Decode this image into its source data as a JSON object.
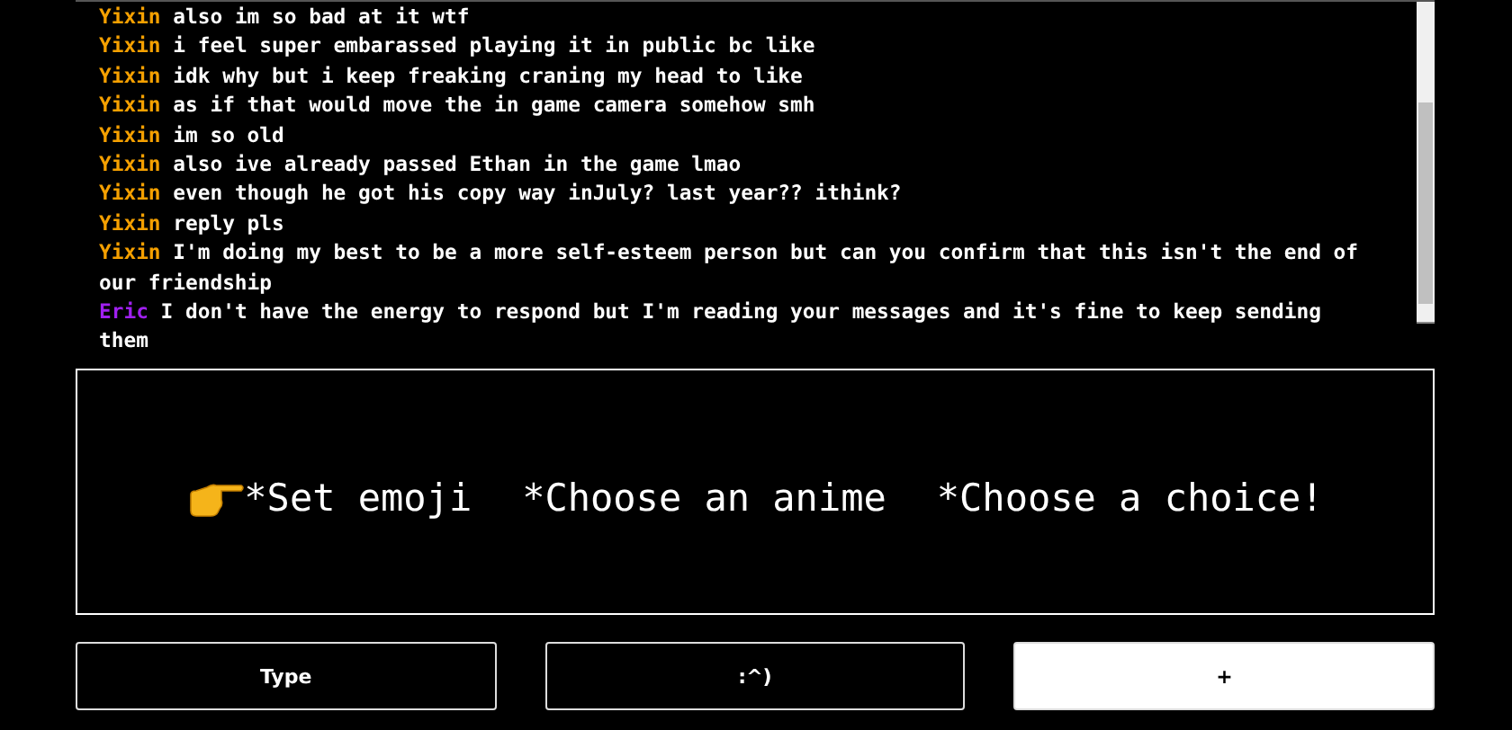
{
  "messages": [
    {
      "author": "Yixin",
      "color": "#f5a000",
      "text": "also im so bad at it wtf"
    },
    {
      "author": "Yixin",
      "color": "#f5a000",
      "text": "i feel super embarassed playing it in public bc like"
    },
    {
      "author": "Yixin",
      "color": "#f5a000",
      "text": "idk why but i keep freaking craning my head to like"
    },
    {
      "author": "Yixin",
      "color": "#f5a000",
      "text": "as if that would move the in game camera somehow smh"
    },
    {
      "author": "Yixin",
      "color": "#f5a000",
      "text": "im so old"
    },
    {
      "author": "Yixin",
      "color": "#f5a000",
      "text": "also ive already passed Ethan in the game lmao"
    },
    {
      "author": "Yixin",
      "color": "#f5a000",
      "text": "even though he got his copy way inJuly? last year?? ithink?"
    },
    {
      "author": "Yixin",
      "color": "#f5a000",
      "text": "reply pls"
    },
    {
      "author": "Yixin",
      "color": "#f5a000",
      "text": "I'm doing my best to be a more self-esteem person but can you confirm that this isn't the end of our friendship"
    },
    {
      "author": "Eric",
      "color": "#a020f0",
      "text": "I don't have the energy to respond but I'm reading your messages and it's fine to keep sending them"
    }
  ],
  "menu": {
    "options": [
      "*Set emoji",
      "*Choose an anime",
      "*Choose a choice!"
    ]
  },
  "buttons": [
    {
      "label": "Type",
      "selected": false
    },
    {
      "label": ":^)",
      "selected": false
    },
    {
      "label": "+",
      "selected": true
    }
  ]
}
